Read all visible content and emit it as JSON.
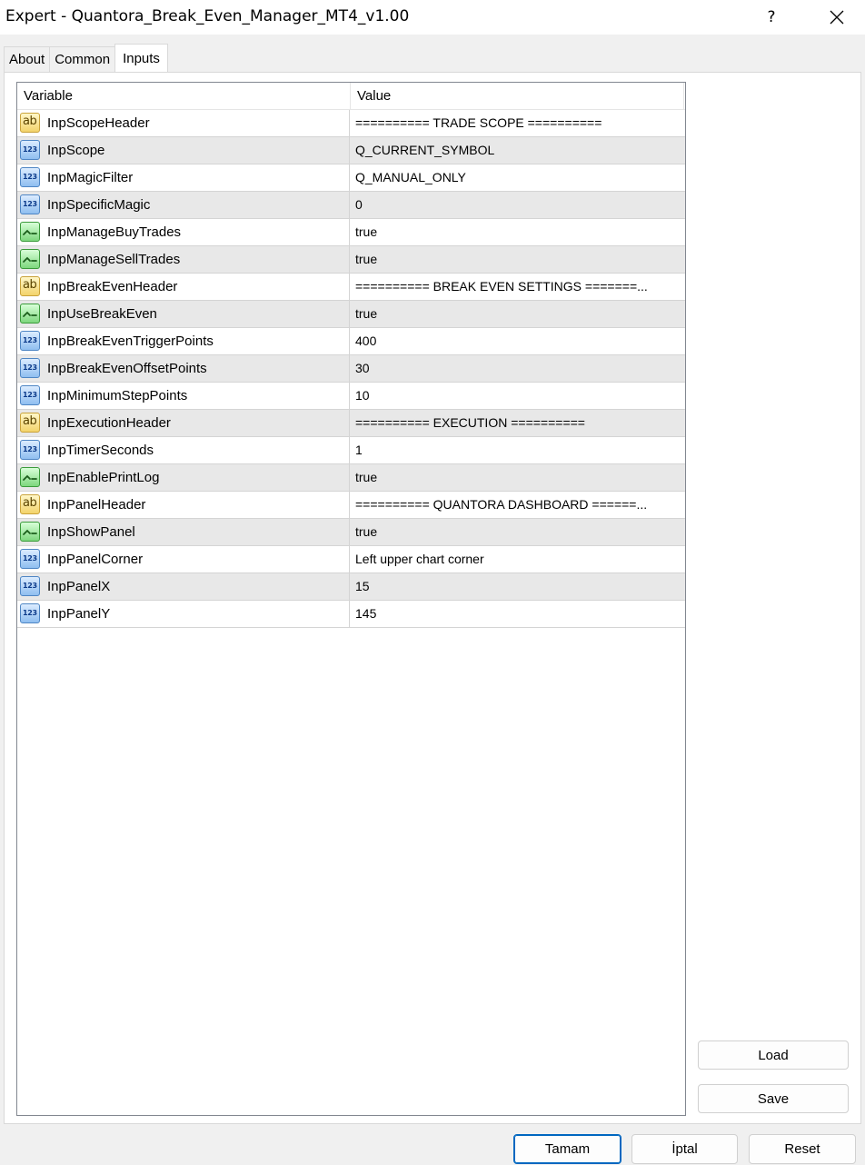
{
  "window": {
    "title": "Expert - Quantora_Break_Even_Manager_MT4_v1.00",
    "help_label": "?",
    "close_icon": "close-icon"
  },
  "tabs": [
    {
      "label": "About",
      "active": false
    },
    {
      "label": "Common",
      "active": false
    },
    {
      "label": "Inputs",
      "active": true
    }
  ],
  "grid": {
    "columns": [
      "Variable",
      "Value"
    ],
    "rows": [
      {
        "type": "string",
        "icon": "string-type-icon",
        "name": "InpScopeHeader",
        "value": "========== TRADE SCOPE =========="
      },
      {
        "type": "int",
        "icon": "integer-type-icon",
        "name": "InpScope",
        "value": "Q_CURRENT_SYMBOL"
      },
      {
        "type": "int",
        "icon": "integer-type-icon",
        "name": "InpMagicFilter",
        "value": "Q_MANUAL_ONLY"
      },
      {
        "type": "int",
        "icon": "integer-type-icon",
        "name": "InpSpecificMagic",
        "value": "0"
      },
      {
        "type": "bool",
        "icon": "boolean-type-icon",
        "name": "InpManageBuyTrades",
        "value": "true"
      },
      {
        "type": "bool",
        "icon": "boolean-type-icon",
        "name": "InpManageSellTrades",
        "value": "true"
      },
      {
        "type": "string",
        "icon": "string-type-icon",
        "name": "InpBreakEvenHeader",
        "value": "========== BREAK EVEN SETTINGS =======..."
      },
      {
        "type": "bool",
        "icon": "boolean-type-icon",
        "name": "InpUseBreakEven",
        "value": "true"
      },
      {
        "type": "int",
        "icon": "integer-type-icon",
        "name": "InpBreakEvenTriggerPoints",
        "value": "400"
      },
      {
        "type": "int",
        "icon": "integer-type-icon",
        "name": "InpBreakEvenOffsetPoints",
        "value": "30"
      },
      {
        "type": "int",
        "icon": "integer-type-icon",
        "name": "InpMinimumStepPoints",
        "value": "10"
      },
      {
        "type": "string",
        "icon": "string-type-icon",
        "name": "InpExecutionHeader",
        "value": "========== EXECUTION =========="
      },
      {
        "type": "int",
        "icon": "integer-type-icon",
        "name": "InpTimerSeconds",
        "value": "1"
      },
      {
        "type": "bool",
        "icon": "boolean-type-icon",
        "name": "InpEnablePrintLog",
        "value": "true"
      },
      {
        "type": "string",
        "icon": "string-type-icon",
        "name": "InpPanelHeader",
        "value": "========== QUANTORA DASHBOARD ======..."
      },
      {
        "type": "bool",
        "icon": "boolean-type-icon",
        "name": "InpShowPanel",
        "value": "true"
      },
      {
        "type": "int",
        "icon": "integer-type-icon",
        "name": "InpPanelCorner",
        "value": "Left upper chart corner"
      },
      {
        "type": "int",
        "icon": "integer-type-icon",
        "name": "InpPanelX",
        "value": "15"
      },
      {
        "type": "int",
        "icon": "integer-type-icon",
        "name": "InpPanelY",
        "value": "145"
      }
    ]
  },
  "icon_glyphs": {
    "string": "ab",
    "int": "123"
  },
  "side_buttons": {
    "load": "Load",
    "save": "Save"
  },
  "footer_buttons": {
    "ok": "Tamam",
    "cancel": "İptal",
    "reset": "Reset"
  },
  "colors": {
    "accent": "#0067c0",
    "row_alt": "#e8e8e8",
    "grid_line": "#d4d4d4"
  }
}
